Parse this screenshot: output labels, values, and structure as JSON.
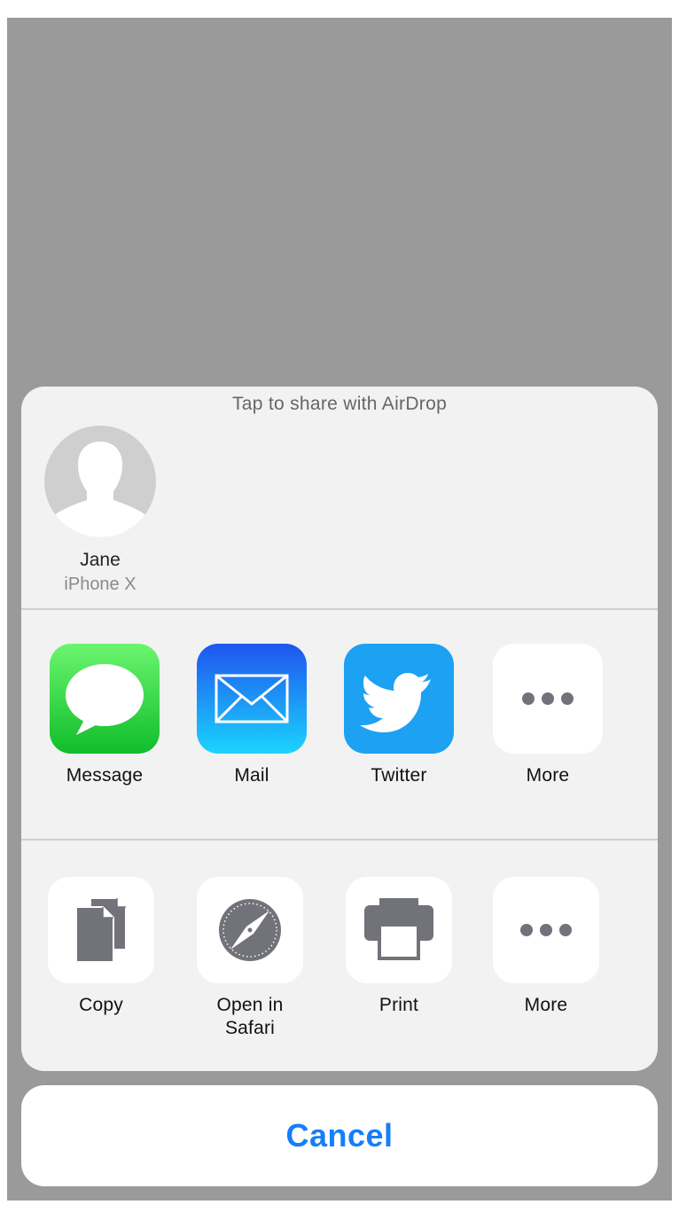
{
  "airdrop": {
    "title": "Tap to share with AirDrop",
    "contact": {
      "name": "Jane",
      "device": "iPhone X"
    }
  },
  "share_row": [
    {
      "label": "Message",
      "icon": "message-icon"
    },
    {
      "label": "Mail",
      "icon": "mail-icon"
    },
    {
      "label": "Twitter",
      "icon": "twitter-icon"
    },
    {
      "label": "More",
      "icon": "more-icon"
    }
  ],
  "action_row": [
    {
      "label": "Copy",
      "icon": "copy-icon"
    },
    {
      "label": "Open in Safari",
      "icon": "safari-icon"
    },
    {
      "label": "Print",
      "icon": "print-icon"
    },
    {
      "label": "More",
      "icon": "more-icon"
    }
  ],
  "cancel_label": "Cancel",
  "colors": {
    "accent": "#157efb",
    "message_top": "#6cf56f",
    "message_bottom": "#0fbd2a",
    "mail_top": "#1e55ef",
    "mail_bottom": "#1cd4fd",
    "twitter": "#1da1f2"
  }
}
